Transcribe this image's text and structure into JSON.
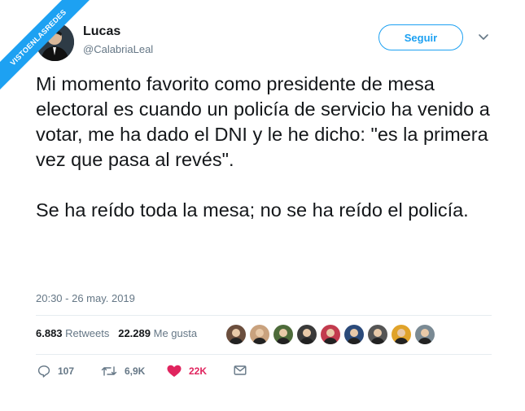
{
  "watermark": {
    "text": "VISTOENLASREDES"
  },
  "user": {
    "name": "Lucas",
    "handle": "@CalabriaLeal",
    "follow_label": "Seguir"
  },
  "tweet": {
    "paragraph1": "Mi momento favorito como presidente de mesa electoral es cuando un policía de servicio ha venido a votar, me ha dado el DNI y le he dicho: \"es la primera vez que pasa al revés\".",
    "paragraph2": "Se ha reído toda la mesa; no se ha reído el policía.",
    "timestamp": "20:30 - 26 may. 2019"
  },
  "stats": {
    "retweets_count": "6.883",
    "retweets_label": "Retweets",
    "likes_count": "22.289",
    "likes_label": "Me gusta"
  },
  "likers": [
    {
      "icon": "liker-avatar-1",
      "color": "#6b4e3d"
    },
    {
      "icon": "liker-avatar-2",
      "color": "#c9a27e"
    },
    {
      "icon": "liker-avatar-3",
      "color": "#4d6b3a"
    },
    {
      "icon": "liker-avatar-4",
      "color": "#3a3a3a"
    },
    {
      "icon": "liker-avatar-5",
      "color": "#c23b4e"
    },
    {
      "icon": "liker-avatar-6",
      "color": "#2b4a7a"
    },
    {
      "icon": "liker-avatar-7",
      "color": "#555555"
    },
    {
      "icon": "liker-avatar-8",
      "color": "#e0a32a"
    },
    {
      "icon": "liker-avatar-9",
      "color": "#7a8a94"
    }
  ],
  "actions": {
    "replies": "107",
    "retweets": "6,9K",
    "likes": "22K"
  },
  "colors": {
    "accent": "#1da1f2",
    "like": "#e0245e",
    "muted": "#657786",
    "text": "#14171a",
    "divider": "#e6ecf0"
  }
}
